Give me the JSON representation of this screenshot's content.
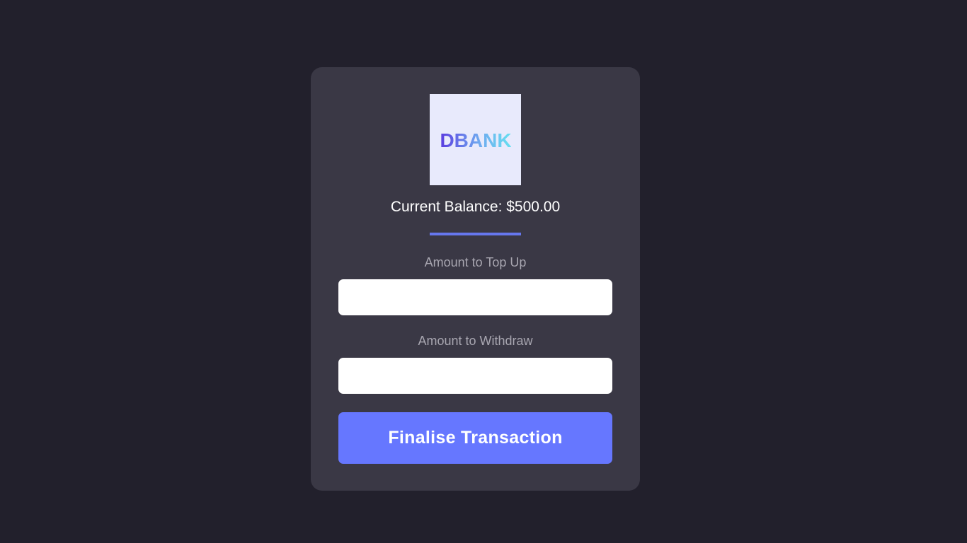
{
  "brand": {
    "logo_text": "DBANK",
    "logo_gradient": [
      "#5a3ce0",
      "#6fa9f0",
      "#66e0f0"
    ],
    "logo_background": "#e8eafc"
  },
  "balance": {
    "text": "Current Balance: $500.00"
  },
  "top_up": {
    "label": "Amount to Top Up",
    "value": "",
    "placeholder": ""
  },
  "withdraw": {
    "label": "Amount to Withdraw",
    "value": "",
    "placeholder": ""
  },
  "actions": {
    "finalise_label": "Finalise Transaction"
  },
  "colors": {
    "page_background": "#22202c",
    "card_background": "#3a3845",
    "accent": "#6677ff",
    "label_text": "#a8a6b0"
  }
}
